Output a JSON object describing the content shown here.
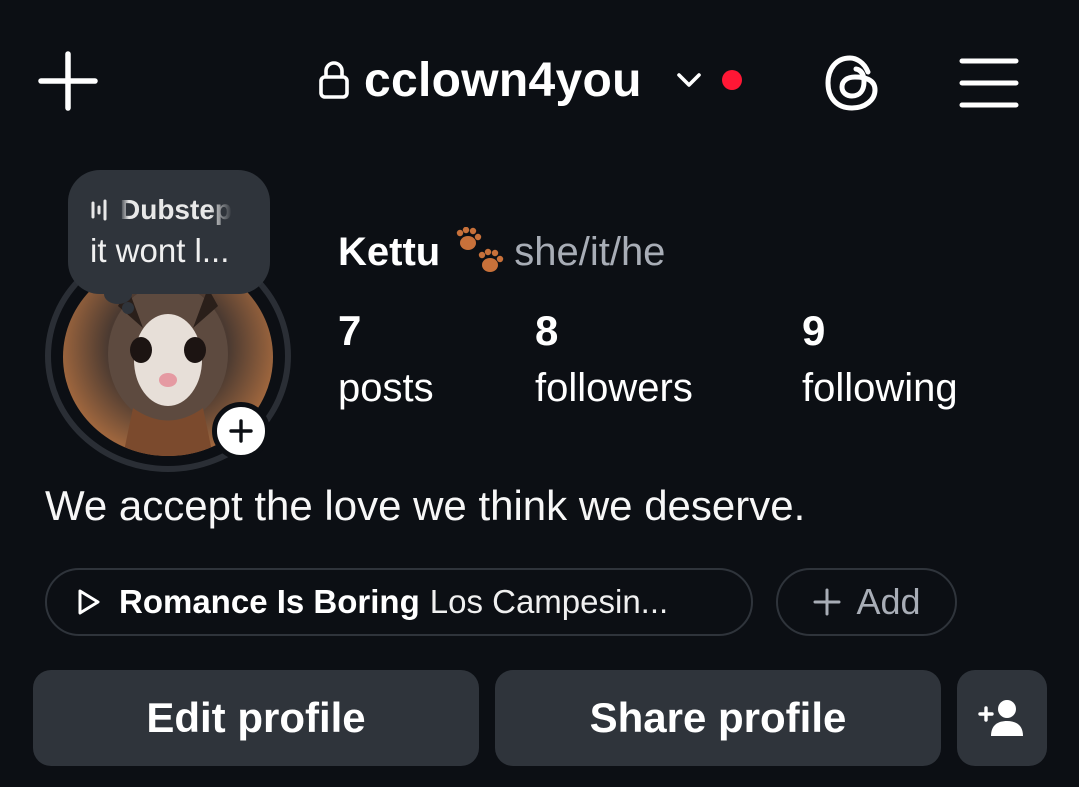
{
  "header": {
    "username": "cclown4you",
    "icons": {
      "create": "plus-icon",
      "lock": "lock-icon",
      "switch": "chevron-down-icon",
      "threads": "threads-icon",
      "menu": "hamburger-menu-icon"
    },
    "notification_dot_color": "#ff1735"
  },
  "note": {
    "music_text": "Dubstep",
    "text": "it wont l..."
  },
  "profile": {
    "display_name": "Kettu",
    "pronouns": "she/it/he",
    "bio": "We accept the love we think we deserve."
  },
  "stats": {
    "posts": {
      "value": "7",
      "label": "posts"
    },
    "followers": {
      "value": "8",
      "label": "followers"
    },
    "following": {
      "value": "9",
      "label": "following"
    }
  },
  "music": {
    "title": "Romance Is Boring",
    "artist": "Los Campesin..."
  },
  "add_pill": {
    "label": "Add"
  },
  "actions": {
    "edit": "Edit profile",
    "share": "Share profile"
  },
  "colors": {
    "background": "#0c0f14",
    "button": "#2f343b",
    "secondary_text": "#a8adb6"
  }
}
